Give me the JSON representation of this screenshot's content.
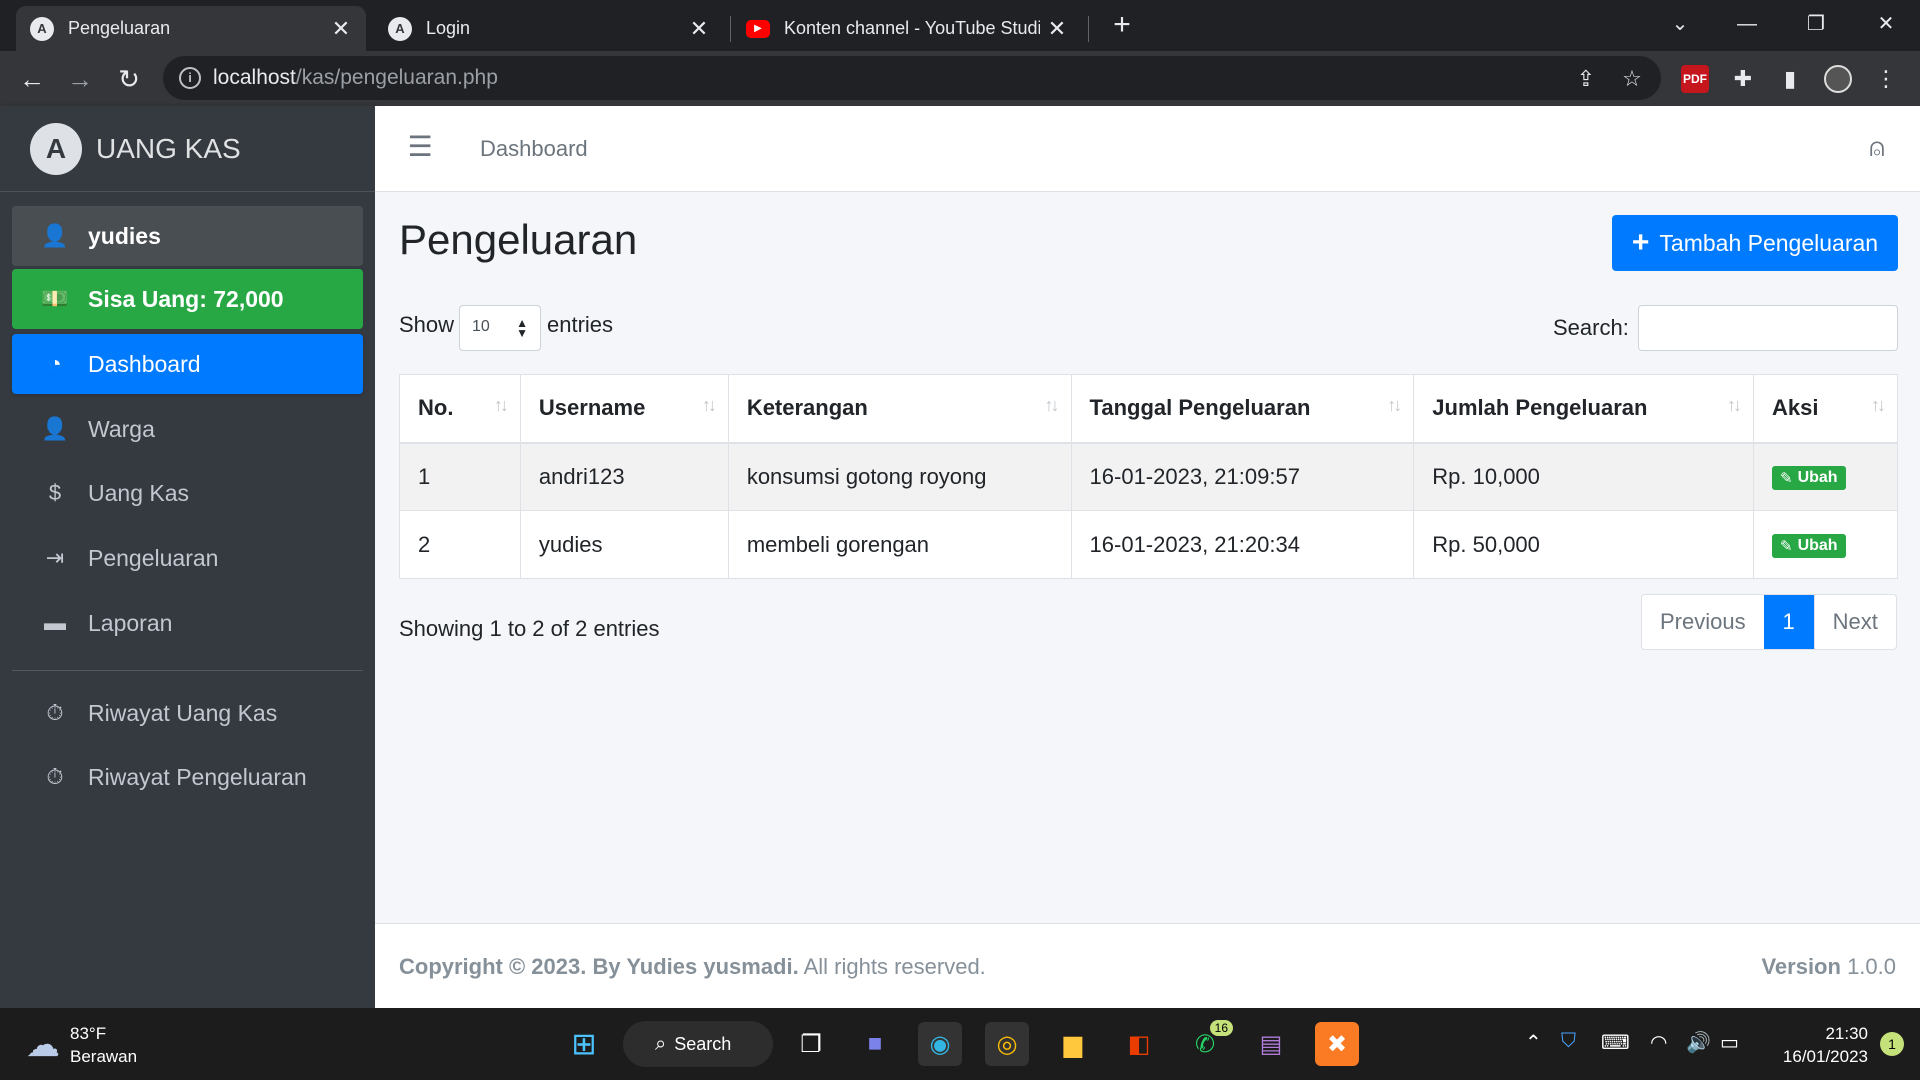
{
  "browser": {
    "tabs": [
      {
        "title": "Pengeluaran",
        "favicon": "A",
        "active": true
      },
      {
        "title": "Login",
        "favicon": "A",
        "active": false
      },
      {
        "title": "Konten channel - YouTube Studio",
        "favicon": "▶",
        "active": false
      }
    ],
    "url_host": "localhost",
    "url_path": "/kas/pengeluaran.php"
  },
  "sidebar": {
    "brand_logo": "A",
    "brand_name": "UANG KAS",
    "user": {
      "label": "yudies",
      "icon": "user-icon"
    },
    "balance": {
      "label": "Sisa Uang: 72,000",
      "icon": "money-icon"
    },
    "items": [
      {
        "label": "Dashboard",
        "icon": "dashboard-icon",
        "active": true
      },
      {
        "label": "Warga",
        "icon": "user-tie-icon"
      },
      {
        "label": "Uang Kas",
        "icon": "dollar-icon"
      },
      {
        "label": "Pengeluaran",
        "icon": "sign-out-icon"
      },
      {
        "label": "Laporan",
        "icon": "file-icon"
      }
    ],
    "history_items": [
      {
        "label": "Riwayat Uang Kas",
        "icon": "stopwatch-icon"
      },
      {
        "label": "Riwayat Pengeluaran",
        "icon": "stopwatch-icon"
      }
    ]
  },
  "topnav": {
    "breadcrumb": "Dashboard"
  },
  "main": {
    "title": "Pengeluaran",
    "add_button": "Tambah Pengeluaran",
    "show_label": "Show",
    "entries_select": "10",
    "entries_label": "entries",
    "search_label": "Search:",
    "search_value": "",
    "table": {
      "headers": [
        "No.",
        "Username",
        "Keterangan",
        "Tanggal Pengeluaran",
        "Jumlah Pengeluaran",
        "Aksi"
      ],
      "rows": [
        {
          "no": "1",
          "username": "andri123",
          "keterangan": "konsumsi gotong royong",
          "tanggal": "16-01-2023, 21:09:57",
          "jumlah": "Rp. 10,000",
          "aksi": "Ubah"
        },
        {
          "no": "2",
          "username": "yudies",
          "keterangan": "membeli gorengan",
          "tanggal": "16-01-2023, 21:20:34",
          "jumlah": "Rp. 50,000",
          "aksi": "Ubah"
        }
      ]
    },
    "info": "Showing 1 to 2 of 2 entries",
    "pagination": {
      "previous": "Previous",
      "current": "1",
      "next": "Next"
    }
  },
  "footer": {
    "copyright_bold": "Copyright © 2023. By Yudies yusmadi.",
    "copyright_rest": " All rights reserved.",
    "version_label": "Version",
    "version_value": "1.0.0"
  },
  "taskbar": {
    "temp": "83°F",
    "weather": "Berawan",
    "search": "Search",
    "whatsapp_badge": "16",
    "time": "21:30",
    "date": "16/01/2023",
    "notifications": "1"
  },
  "colors": {
    "primary": "#007bff",
    "success": "#28a745",
    "sidebar": "#343a40"
  }
}
